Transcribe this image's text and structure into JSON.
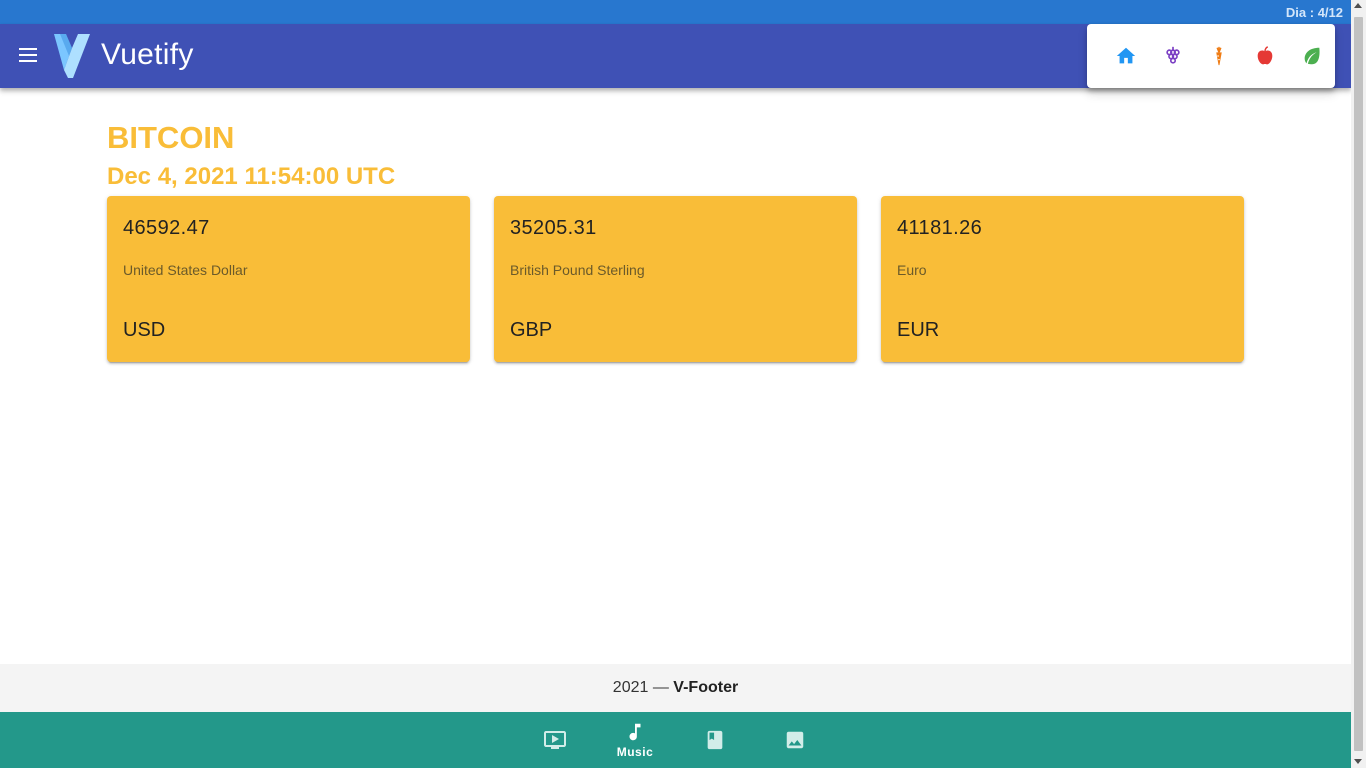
{
  "system_bar": {
    "day_label": "Dia : 4/12"
  },
  "app_bar": {
    "brand": "Vuetify",
    "menu_icon": "hamburger-menu-icon",
    "quick_menu": [
      {
        "icon": "home-icon",
        "color": "#2196f3"
      },
      {
        "icon": "grapes-icon",
        "color": "#7b3fc4"
      },
      {
        "icon": "carrot-icon",
        "color": "#ef7c14"
      },
      {
        "icon": "apple-icon",
        "color": "#e53935"
      },
      {
        "icon": "leaf-icon",
        "color": "#4caf50"
      }
    ]
  },
  "main": {
    "title": "BITCOIN",
    "datetime": "Dec 4, 2021 11:54:00 UTC",
    "cards": [
      {
        "rate": "46592.47",
        "name": "United States Dollar",
        "code": "USD"
      },
      {
        "rate": "35205.31",
        "name": "British Pound Sterling",
        "code": "GBP"
      },
      {
        "rate": "41181.26",
        "name": "Euro",
        "code": "EUR"
      }
    ]
  },
  "footer": {
    "year": "2021",
    "separator": "—",
    "name": "V-Footer"
  },
  "bottom_nav": [
    {
      "icon": "video-icon",
      "label": ""
    },
    {
      "icon": "music-note-icon",
      "label": "Music"
    },
    {
      "icon": "book-icon",
      "label": ""
    },
    {
      "icon": "image-icon",
      "label": ""
    }
  ],
  "colors": {
    "system_bar": "#2877cf",
    "app_bar": "#3f51b5",
    "accent": "#f9bd38",
    "bottom_nav": "#23988a",
    "footer": "#f4f4f4"
  }
}
